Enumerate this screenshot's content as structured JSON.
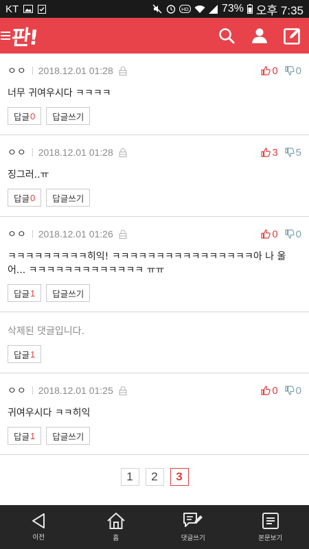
{
  "status_bar": {
    "carrier": "KT",
    "battery": "73%",
    "time": "오후 7:35"
  },
  "header": {
    "logo": "판!",
    "icons": [
      "menu-icon",
      "search-icon",
      "user-icon",
      "compose-icon"
    ]
  },
  "comments": [
    {
      "author": "ㅇㅇ",
      "date": "2018.12.01 01:28",
      "up": "0",
      "down": "0",
      "text": "너무 귀여우시다 ㅋㅋㅋㅋ",
      "reply_label": "답글",
      "reply_count": "0",
      "write_label": "답글쓰기"
    },
    {
      "author": "ㅇㅇ",
      "date": "2018.12.01 01:28",
      "up": "3",
      "down": "5",
      "text": "징그러..ㅠ",
      "reply_label": "답글",
      "reply_count": "0",
      "write_label": "답글쓰기"
    },
    {
      "author": "ㅇㅇ",
      "date": "2018.12.01 01:26",
      "up": "0",
      "down": "0",
      "text": "ㅋㅋㅋㅋㅋㅋㅋㅋㅋ히익! ㅋㅋㅋㅋㅋㅋㅋㅋㅋㅋㅋㅋㅋㅋㅋㅋ아 나 울어... ㅋㅋㅋㅋㅋㅋㅋㅋㅋㅋㅋㅋㅋ ㅠㅠ",
      "reply_label": "답글",
      "reply_count": "1",
      "write_label": "답글쓰기"
    },
    {
      "deleted_text": "삭제된 댓글입니다.",
      "reply_label": "답글",
      "reply_count": "1"
    },
    {
      "author": "ㅇㅇ",
      "date": "2018.12.01 01:25",
      "up": "0",
      "down": "0",
      "text": "귀여우시다 ㅋㅋ히익",
      "reply_label": "답글",
      "reply_count": "1",
      "write_label": "답글쓰기"
    }
  ],
  "pagination": {
    "pages": [
      "1",
      "2",
      "3"
    ],
    "active": "3"
  },
  "bottom_nav": {
    "back": "이전",
    "home": "홈",
    "write_comment": "댓글쓰기",
    "view_post": "본문보기"
  },
  "colors": {
    "brand": "#e8434a",
    "upvote": "#e53b3b",
    "downvote": "#7d9fa8",
    "nav_bg": "#262626"
  }
}
